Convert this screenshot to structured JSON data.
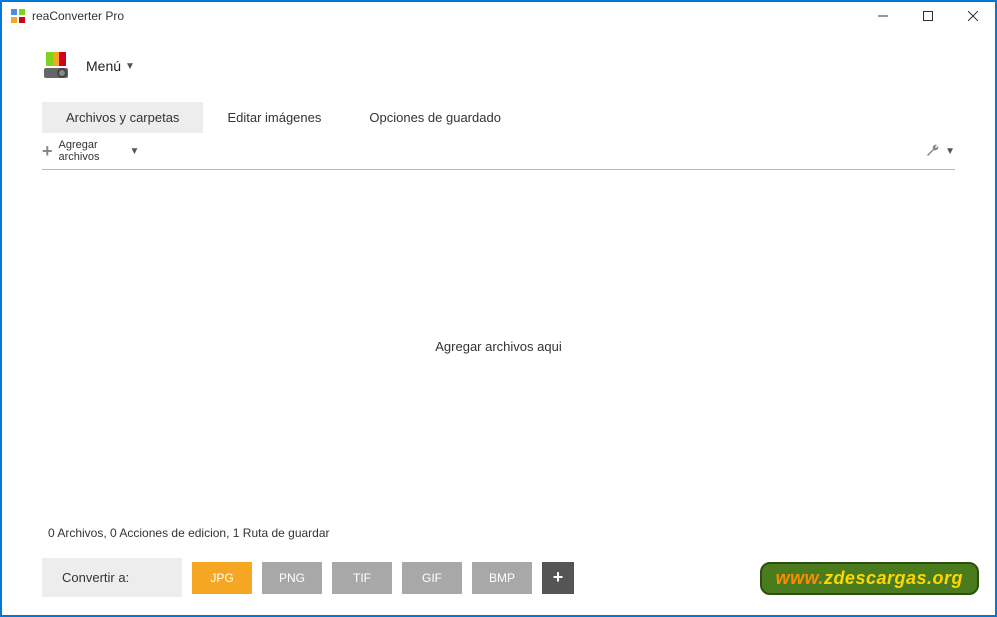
{
  "window": {
    "title": "reaConverter Pro"
  },
  "menu": {
    "label": "Menú"
  },
  "tabs": {
    "files": "Archivos y carpetas",
    "edit": "Editar imágenes",
    "save": "Opciones de guardado"
  },
  "toolbar": {
    "add_line1": "Agregar",
    "add_line2": "archivos"
  },
  "drop": {
    "text": "Agregar archivos aqui"
  },
  "status": {
    "text": "0 Archivos, 0 Acciones de edicion, 1 Ruta de guardar"
  },
  "bottom": {
    "convert_label": "Convertir a:",
    "formats": {
      "jpg": "JPG",
      "png": "PNG",
      "tif": "TIF",
      "gif": "GIF",
      "bmp": "BMP"
    },
    "plus": "+"
  },
  "watermark": {
    "prefix": "www.",
    "main": "zdescargas.org"
  }
}
